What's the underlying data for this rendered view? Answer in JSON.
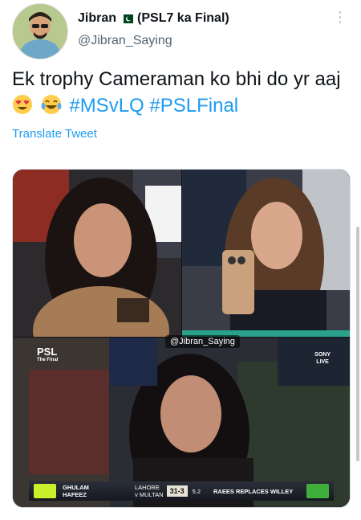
{
  "author": {
    "display_name": "Jibran",
    "name_suffix": "(PSL7 ka Final)",
    "handle": "@Jibran_Saying"
  },
  "tweet": {
    "text_part1": "Ek trophy Cameraman ko bhi do yr aaj",
    "hashtag1": "#MSvLQ",
    "hashtag2": "#PSLFinal",
    "translate_label": "Translate Tweet"
  },
  "media": {
    "watermark": "@Jibran_Saying",
    "psl_badge_line1": "PSL",
    "psl_badge_line2": "The Final",
    "broadcaster_line1": "SONY",
    "broadcaster_line2": "LIVE",
    "scorebar": {
      "player_line1": "GHULAM",
      "player_line2": "HAFEEZ",
      "team": "LAHORE",
      "opponent": "v MULTAN",
      "score": "31-3",
      "over": "5.2",
      "message": "RAEES REPLACES WILLEY"
    }
  },
  "colors": {
    "accent": "#1d9bf0",
    "text": "#0f1419",
    "secondary_text": "#536471"
  }
}
